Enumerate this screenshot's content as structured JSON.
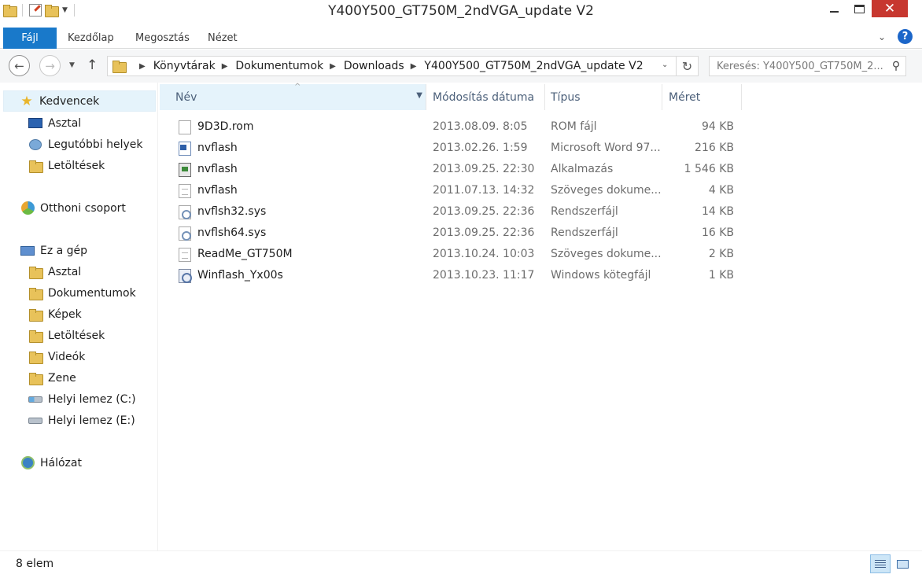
{
  "window": {
    "title": "Y400Y500_GT750M_2ndVGA_update V2",
    "close_glyph": "✕"
  },
  "ribbon": {
    "tabs": [
      {
        "label": "Fájl"
      },
      {
        "label": "Kezdőlap"
      },
      {
        "label": "Megosztás"
      },
      {
        "label": "Nézet"
      }
    ],
    "help_glyph": "?"
  },
  "nav": {
    "breadcrumbs": [
      "Könyvtárak",
      "Dokumentumok",
      "Downloads",
      "Y400Y500_GT750M_2ndVGA_update V2"
    ],
    "search_placeholder": "Keresés: Y400Y500_GT750M_2..."
  },
  "sidebar": {
    "favorites": {
      "label": "Kedvencek",
      "items": [
        {
          "label": "Asztal",
          "icon": "desktop-icon"
        },
        {
          "label": "Legutóbbi helyek",
          "icon": "recent-places-icon"
        },
        {
          "label": "Letöltések",
          "icon": "downloads-folder-icon"
        }
      ]
    },
    "homegroup": {
      "label": "Otthoni csoport"
    },
    "this_pc": {
      "label": "Ez a gép",
      "items": [
        {
          "label": "Asztal",
          "icon": "folder-icon"
        },
        {
          "label": "Dokumentumok",
          "icon": "folder-icon"
        },
        {
          "label": "Képek",
          "icon": "folder-icon"
        },
        {
          "label": "Letöltések",
          "icon": "folder-icon"
        },
        {
          "label": "Videók",
          "icon": "folder-icon"
        },
        {
          "label": "Zene",
          "icon": "folder-icon"
        },
        {
          "label": "Helyi lemez (C:)",
          "icon": "drive-icon"
        },
        {
          "label": "Helyi lemez (E:)",
          "icon": "drive-icon"
        }
      ]
    },
    "network": {
      "label": "Hálózat"
    }
  },
  "columns": {
    "name": "Név",
    "date": "Módosítás dátuma",
    "type": "Típus",
    "size": "Méret"
  },
  "files": [
    {
      "name": "9D3D.rom",
      "date": "2013.08.09. 8:05",
      "type": "ROM fájl",
      "size": "94 KB",
      "icon": "file-icon"
    },
    {
      "name": "nvflash",
      "date": "2013.02.26. 1:59",
      "type": "Microsoft Word 97...",
      "size": "216 KB",
      "icon": "word-document-icon"
    },
    {
      "name": "nvflash",
      "date": "2013.09.25. 22:30",
      "type": "Alkalmazás",
      "size": "1 546 KB",
      "icon": "application-icon"
    },
    {
      "name": "nvflash",
      "date": "2011.07.13. 14:32",
      "type": "Szöveges dokume...",
      "size": "4 KB",
      "icon": "text-document-icon"
    },
    {
      "name": "nvflsh32.sys",
      "date": "2013.09.25. 22:36",
      "type": "Rendszerfájl",
      "size": "14 KB",
      "icon": "system-file-icon"
    },
    {
      "name": "nvflsh64.sys",
      "date": "2013.09.25. 22:36",
      "type": "Rendszerfájl",
      "size": "16 KB",
      "icon": "system-file-icon"
    },
    {
      "name": "ReadMe_GT750M",
      "date": "2013.10.24. 10:03",
      "type": "Szöveges dokume...",
      "size": "2 KB",
      "icon": "text-document-icon"
    },
    {
      "name": "Winflash_Yx00s",
      "date": "2013.10.23. 11:17",
      "type": "Windows kötegfájl",
      "size": "1 KB",
      "icon": "batch-file-icon"
    }
  ],
  "status": {
    "item_count": "8 elem"
  }
}
